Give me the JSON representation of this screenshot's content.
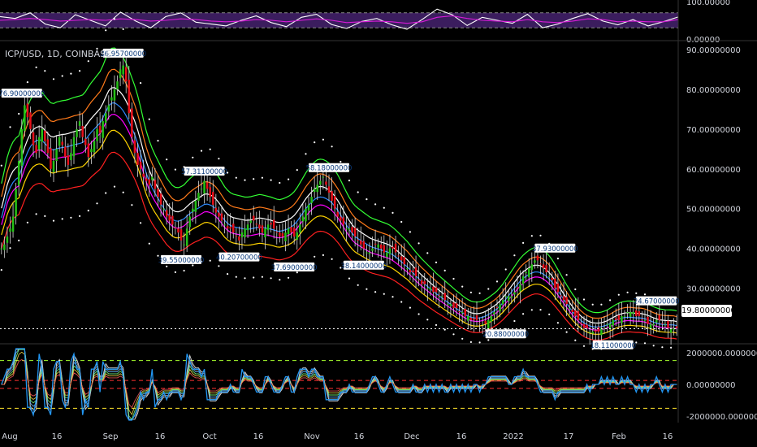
{
  "header": {
    "symbol": "ICP/USD, 1D, COINBASE"
  },
  "colors": {
    "up": "#26c217",
    "down": "#e8101a",
    "bg": "#000000",
    "rsi_band": "#3b1d5e",
    "osc_line": "#2196f3",
    "ribbon": [
      "#ff2020",
      "#ffd400",
      "#ff00ff",
      "#2f8bff",
      "#ffffff",
      "#ff7a1a",
      "#33ff33"
    ]
  },
  "chart_data": [
    {
      "type": "line",
      "title": "",
      "ylabel": "",
      "y_ticks": [
        "100.00000",
        "0.00000"
      ],
      "ylim": [
        0,
        100
      ],
      "bands": [
        30,
        70
      ],
      "series": [
        {
          "values": [
            60,
            55,
            70,
            40,
            30,
            65,
            50,
            35,
            72,
            48,
            30,
            60,
            70,
            45,
            40,
            35,
            50,
            62,
            44,
            33,
            58,
            66,
            39,
            28,
            47,
            55,
            38,
            26,
            52,
            80,
            65,
            36,
            58,
            50,
            42,
            66,
            30,
            40,
            55,
            68,
            48,
            38,
            52,
            35,
            46,
            59
          ]
        },
        {
          "values": [
            50,
            52,
            55,
            52,
            48,
            50,
            52,
            50,
            54,
            52,
            48,
            50,
            54,
            52,
            48,
            46,
            48,
            52,
            50,
            46,
            50,
            54,
            50,
            44,
            46,
            48,
            46,
            42,
            46,
            58,
            62,
            55,
            50,
            48,
            46,
            52,
            46,
            44,
            48,
            54,
            52,
            46,
            48,
            46,
            46,
            52
          ]
        }
      ]
    },
    {
      "type": "candlestick",
      "title": "",
      "ylabel": "",
      "y_ticks": [
        "90.00000000",
        "80.00000000",
        "70.00000000",
        "60.00000000",
        "50.00000000",
        "40.00000000",
        "30.00000000"
      ],
      "ylim": [
        15,
        90
      ],
      "x_ticks": [
        "Aug",
        "16",
        "Sep",
        "16",
        "Oct",
        "16",
        "Nov",
        "16",
        "Dec",
        "16",
        "2022",
        "17",
        "Feb",
        "16"
      ],
      "last_price": "19.80000000",
      "annotations": [
        {
          "text": "76.90000000",
          "date_index": 7,
          "value": 76.9,
          "pos": "above"
        },
        {
          "text": "86.95700000",
          "date_index": 42,
          "value": 86.957,
          "pos": "above"
        },
        {
          "text": "39.55000000",
          "date_index": 62,
          "value": 39.55,
          "pos": "below"
        },
        {
          "text": "57.31100000",
          "date_index": 70,
          "value": 57.311,
          "pos": "above"
        },
        {
          "text": "40.20700000",
          "date_index": 82,
          "value": 40.207,
          "pos": "below"
        },
        {
          "text": "37.69000000",
          "date_index": 101,
          "value": 37.69,
          "pos": "below"
        },
        {
          "text": "58.18000000",
          "date_index": 113,
          "value": 58.18,
          "pos": "above"
        },
        {
          "text": "38.14000000",
          "date_index": 125,
          "value": 38.14,
          "pos": "below"
        },
        {
          "text": "20.88000000",
          "date_index": 174,
          "value": 20.88,
          "pos": "below"
        },
        {
          "text": "37.93000000",
          "date_index": 191,
          "value": 37.93,
          "pos": "above"
        },
        {
          "text": "18.11000000",
          "date_index": 211,
          "value": 18.11,
          "pos": "below"
        },
        {
          "text": "24.67000000",
          "date_index": 226,
          "value": 24.67,
          "pos": "above"
        }
      ],
      "close_series": [
        40,
        41,
        43,
        45,
        48,
        55,
        62,
        70,
        76,
        73,
        70,
        66,
        64,
        68,
        70,
        67,
        64,
        60,
        62,
        65,
        68,
        66,
        63,
        61,
        64,
        68,
        70,
        72,
        68,
        66,
        63,
        65,
        67,
        70,
        69,
        72,
        74,
        76,
        78,
        80,
        82,
        85,
        86,
        82,
        74,
        68,
        64,
        61,
        60,
        58,
        57,
        56,
        58,
        55,
        53,
        51,
        50,
        48,
        47,
        46,
        45,
        44,
        42,
        41,
        45,
        48,
        50,
        52,
        54,
        55,
        57,
        55,
        53,
        51,
        49,
        48,
        47,
        46,
        45,
        45,
        44,
        43,
        42,
        44,
        45,
        46,
        47,
        47,
        46,
        45,
        44,
        45,
        46,
        46,
        45,
        44,
        43,
        43,
        44,
        45,
        44,
        43,
        44,
        46,
        48,
        50,
        51,
        53,
        55,
        56,
        57,
        58,
        56,
        54,
        52,
        50,
        48,
        47,
        46,
        45,
        45,
        44,
        43,
        42,
        41,
        40,
        39,
        39,
        40,
        41,
        41,
        40,
        39,
        39,
        40,
        40,
        39,
        38,
        37,
        36,
        35,
        34,
        34,
        33,
        32,
        31,
        31,
        30,
        30,
        29,
        29,
        28,
        28,
        27,
        26,
        26,
        25,
        25,
        24,
        24,
        23,
        23,
        22,
        22,
        22,
        21,
        21,
        21,
        22,
        23,
        24,
        25,
        26,
        27,
        28,
        28,
        28,
        29,
        30,
        31,
        33,
        34,
        35,
        36,
        37,
        37,
        36,
        35,
        34,
        33,
        32,
        30,
        29,
        28,
        27,
        26,
        25,
        24,
        23,
        22,
        21,
        20,
        20,
        19,
        19,
        19,
        19,
        20,
        20,
        21,
        21,
        22,
        22,
        22,
        23,
        23,
        24,
        24,
        24,
        23,
        23,
        22,
        22,
        21,
        21,
        21,
        22,
        22,
        21,
        21,
        20,
        20,
        20,
        20
      ]
    },
    {
      "type": "line",
      "title": "",
      "ylabel": "",
      "y_ticks": [
        "2000000.00000000",
        "0.00000000",
        "-2000000.00000000"
      ],
      "ylim": [
        -2300000,
        2300000
      ],
      "bands": [
        1500000,
        250000,
        -250000,
        -1500000
      ]
    }
  ]
}
